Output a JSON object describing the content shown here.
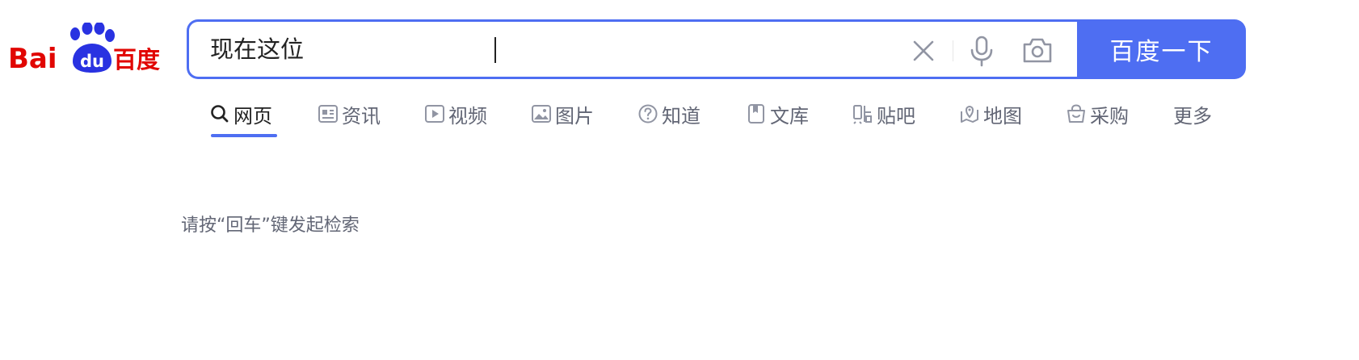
{
  "logo": {
    "latin": "Bai",
    "paw": "du",
    "chinese": "百度"
  },
  "search": {
    "value": "现在这位",
    "placeholder": ""
  },
  "search_button": {
    "label": "百度一下"
  },
  "tabs": [
    {
      "label": "网页",
      "icon": "search-icon",
      "active": true
    },
    {
      "label": "资讯",
      "icon": "news-icon",
      "active": false
    },
    {
      "label": "视频",
      "icon": "video-icon",
      "active": false
    },
    {
      "label": "图片",
      "icon": "image-icon",
      "active": false
    },
    {
      "label": "知道",
      "icon": "question-icon",
      "active": false
    },
    {
      "label": "文库",
      "icon": "document-icon",
      "active": false
    },
    {
      "label": "贴吧",
      "icon": "tieba-icon",
      "active": false
    },
    {
      "label": "地图",
      "icon": "map-icon",
      "active": false
    },
    {
      "label": "采购",
      "icon": "shopping-basket-icon",
      "active": false
    },
    {
      "label": "更多",
      "icon": "",
      "active": false
    }
  ],
  "hint": "请按“回车”键发起检索",
  "colors": {
    "brand_blue": "#4e6ef2",
    "logo_red": "#e10602",
    "logo_blue": "#2932e1",
    "tab_text": "#626675",
    "icon_gray": "#9195a3"
  }
}
